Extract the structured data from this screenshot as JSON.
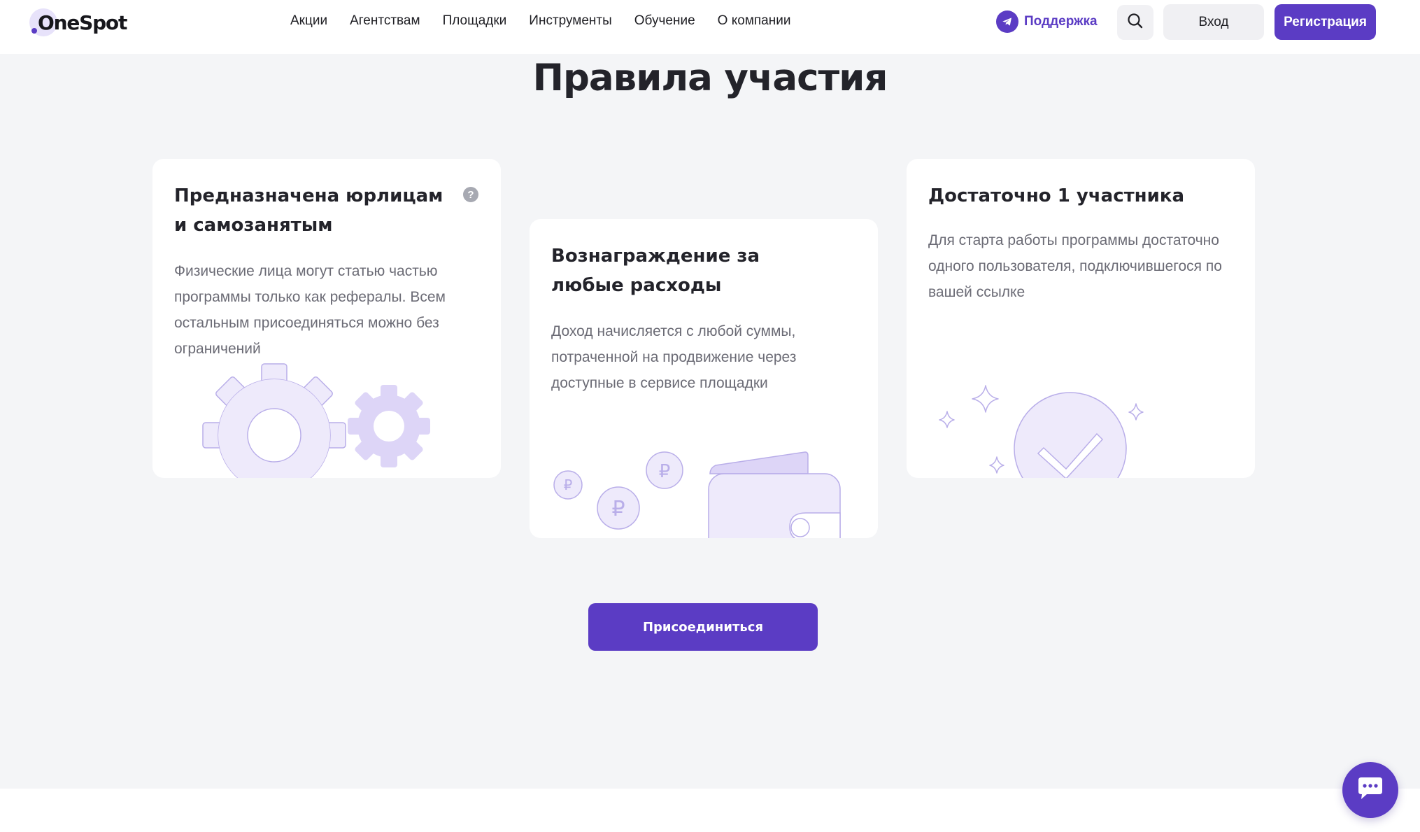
{
  "header": {
    "logo_text": "OneSpot",
    "nav": [
      {
        "label": "Акции"
      },
      {
        "label": "Агентствам"
      },
      {
        "label": "Площадки"
      },
      {
        "label": "Инструменты"
      },
      {
        "label": "Обучение"
      },
      {
        "label": "О компании"
      }
    ],
    "support_label": "Поддержка",
    "login_label": "Вход",
    "register_label": "Регистрация"
  },
  "section": {
    "title": "Правила участия",
    "cards": [
      {
        "title": "Предназначена юрлицам и самозанятым",
        "text": "Физические лица могут статью частью программы только как рефералы. Всем остальным присоединяться можно без ограничений",
        "help": "?",
        "illustration": "gears"
      },
      {
        "title": "Вознаграждение за любые расходы",
        "text": "Доход начисляется с любой суммы, потраченной на продвижение через доступные в сервисе площадки",
        "illustration": "wallet-coins",
        "coin_symbol": "₽"
      },
      {
        "title": "Достаточно 1 участника",
        "text": "Для старта работы программы достаточно одного пользователя, подключившегося по вашей ссылке",
        "illustration": "checkmark-sparkles"
      }
    ],
    "join_label": "Присоединиться"
  },
  "colors": {
    "accent": "#5b3cc4",
    "illustration_fill": "#eeeafb",
    "illustration_stroke": "#b9aee9",
    "section_bg": "#f4f5f7",
    "text_muted": "#6b6b75"
  },
  "icons": {
    "support": "telegram-icon",
    "search": "search-icon",
    "chat": "chat-icon",
    "help": "question-icon"
  }
}
